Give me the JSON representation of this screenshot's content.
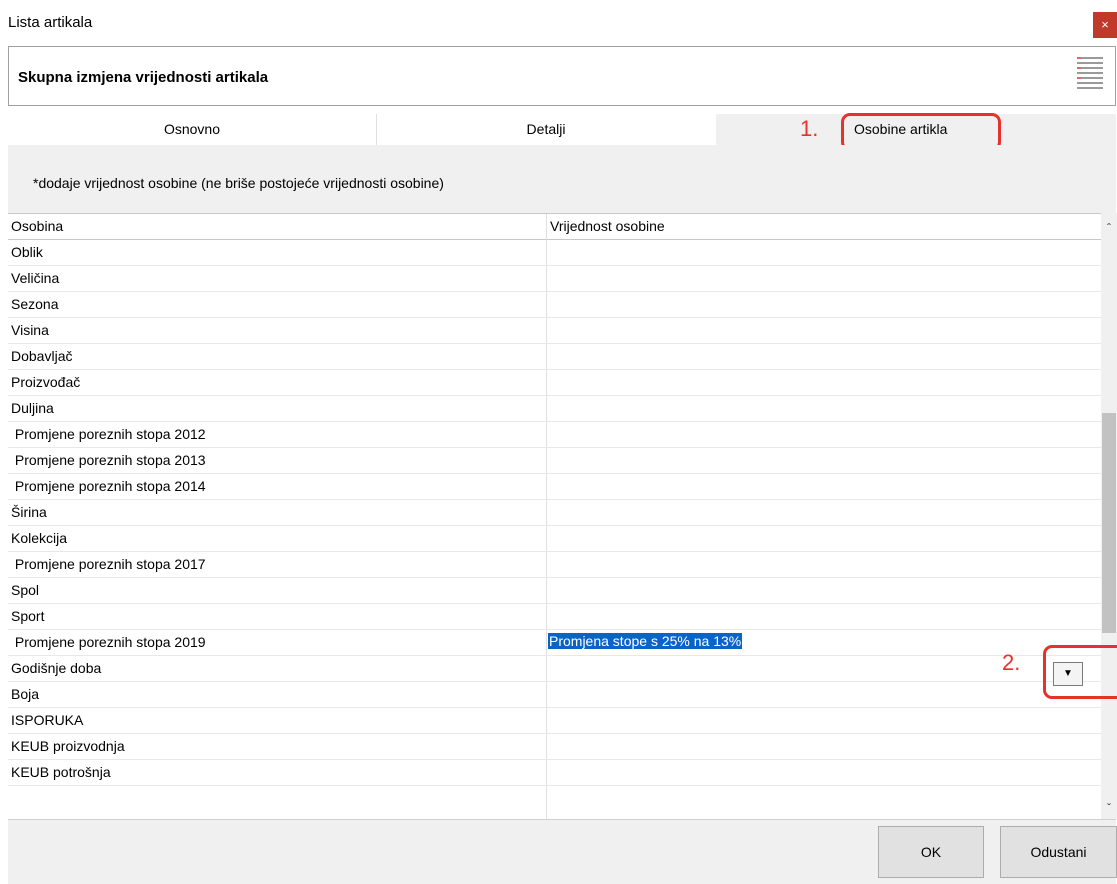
{
  "window": {
    "title": "Lista artikala",
    "close_label": "×"
  },
  "header": {
    "title": "Skupna izmjena vrijednosti artikala",
    "icon": "grid-list-icon"
  },
  "tabs": [
    {
      "label": "Osnovno"
    },
    {
      "label": "Detalji"
    },
    {
      "label": "Osobine artikla",
      "active": true
    }
  ],
  "annotations": {
    "step1": "1.",
    "step2": "2."
  },
  "note": "*dodaje vrijednost osobine (ne briše postojeće vrijednosti osobine)",
  "grid": {
    "columns": [
      "Osobina",
      "Vrijednost osobine"
    ],
    "rows": [
      {
        "name": "Oblik",
        "value": ""
      },
      {
        "name": "Veličina",
        "value": ""
      },
      {
        "name": "Sezona",
        "value": ""
      },
      {
        "name": "Visina",
        "value": ""
      },
      {
        "name": "Dobavljač",
        "value": ""
      },
      {
        "name": "Proizvođač",
        "value": ""
      },
      {
        "name": "Duljina",
        "value": ""
      },
      {
        "name": " Promjene poreznih stopa 2012",
        "value": ""
      },
      {
        "name": " Promjene poreznih stopa 2013",
        "value": ""
      },
      {
        "name": " Promjene poreznih stopa 2014",
        "value": ""
      },
      {
        "name": "Širina",
        "value": ""
      },
      {
        "name": "Kolekcija",
        "value": ""
      },
      {
        "name": " Promjene poreznih stopa 2017",
        "value": ""
      },
      {
        "name": "Spol",
        "value": ""
      },
      {
        "name": "Sport",
        "value": ""
      },
      {
        "name": " Promjene poreznih stopa 2019",
        "value": "Promjena stope s 25% na 13%"
      },
      {
        "name": "Godišnje doba",
        "value": ""
      },
      {
        "name": "Boja",
        "value": ""
      },
      {
        "name": "ISPORUKA",
        "value": ""
      },
      {
        "name": "KEUB proizvodnja",
        "value": ""
      },
      {
        "name": "KEUB potrošnja",
        "value": ""
      }
    ]
  },
  "buttons": {
    "ok": "OK",
    "cancel": "Odustani"
  },
  "colors": {
    "annotation": "#e5322a",
    "selection": "#0a64c8",
    "close": "#c0392b"
  }
}
